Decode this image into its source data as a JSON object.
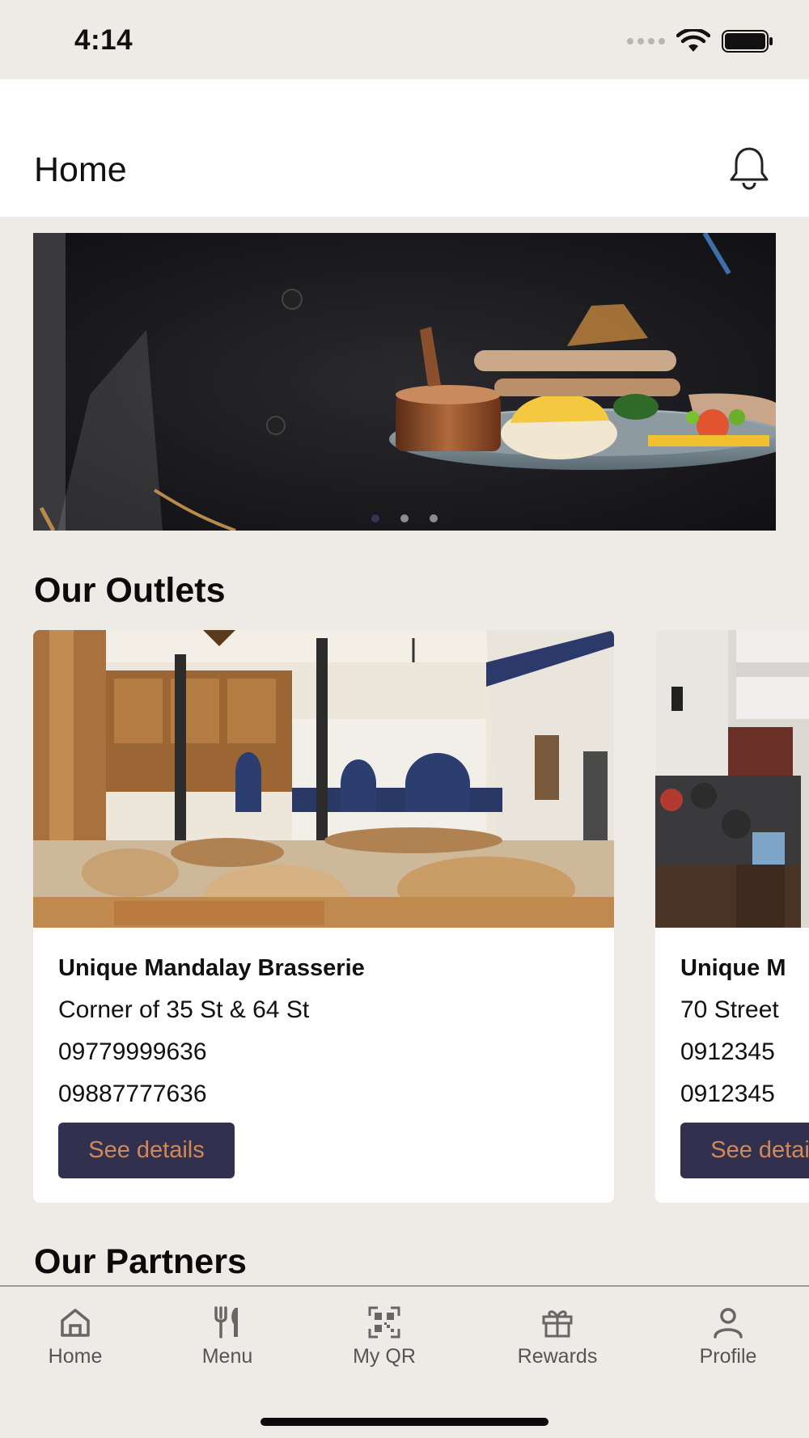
{
  "status_bar": {
    "time": "4:14"
  },
  "header": {
    "title": "Home"
  },
  "banner": {
    "slide_count": 3,
    "active_slide": 1
  },
  "sections": {
    "outlets_title": "Our Outlets",
    "partners_title": "Our Partners"
  },
  "outlets": [
    {
      "name": "Unique Mandalay Brasserie",
      "address": "Corner of 35 St & 64 St",
      "phone1": "09779999636",
      "phone2": "09887777636",
      "button_label": "See details"
    },
    {
      "name": "Unique M",
      "address": "70 Street",
      "phone1": "0912345",
      "phone2": "0912345",
      "button_label": "See details"
    }
  ],
  "bottom_nav": [
    {
      "label": "Home",
      "icon": "home-icon"
    },
    {
      "label": "Menu",
      "icon": "fork-knife-icon"
    },
    {
      "label": "My QR",
      "icon": "qr-code-icon"
    },
    {
      "label": "Rewards",
      "icon": "gift-icon"
    },
    {
      "label": "Profile",
      "icon": "person-icon"
    }
  ],
  "colors": {
    "background": "#eeeae5",
    "button_bg": "#32304f",
    "button_text": "#d1895a",
    "active_dot": "#34345a"
  }
}
